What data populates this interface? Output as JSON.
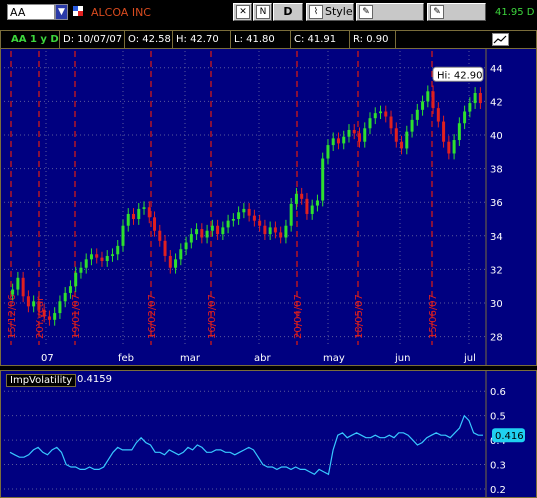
{
  "toolbar": {
    "symbol": "AA",
    "company": "ALCOA INC",
    "d_label": "D",
    "style_label": "Style",
    "drawings_label": "Drawings",
    "studies_label": "Studies",
    "last_price": "41.95 D"
  },
  "info": {
    "title": "AA 1 y D",
    "date": "D: 10/07/07",
    "open": "O: 42.58",
    "high": "H: 42.70",
    "low": "L: 41.80",
    "close": "C: 41.91",
    "range": "R: 0.90"
  },
  "chart_data": [
    {
      "type": "candlestick",
      "ylim": [
        27.5,
        45
      ],
      "y_ticks": [
        "28",
        "30",
        "32",
        "34",
        "36",
        "38",
        "40",
        "42",
        "44"
      ],
      "x_ticks": [
        "07",
        "feb",
        "mar",
        "abr",
        "may",
        "jun",
        "jul"
      ],
      "hi_label": "Hi: 42.90",
      "bubble_value": "",
      "colors": {
        "up": "#2ee02e",
        "down": "#e02020",
        "background": "#000080",
        "grid": "#5a5a9a"
      },
      "event_labels": [
        "15/12/06",
        "20Y.year",
        "19/01/07",
        "16/02/07",
        "16/03/07",
        "20/04/07",
        "18/05/07",
        "15/06/07"
      ],
      "closes": [
        30.8,
        31.5,
        30.4,
        29.8,
        30.1,
        29.6,
        29.2,
        29.0,
        29.4,
        30.1,
        30.6,
        31.0,
        31.8,
        32.1,
        32.6,
        32.9,
        32.7,
        32.5,
        32.8,
        32.9,
        33.4,
        34.6,
        35.3,
        35.0,
        35.6,
        35.7,
        35.1,
        34.3,
        33.7,
        32.8,
        32.1,
        32.6,
        33.2,
        33.6,
        34.1,
        34.4,
        33.9,
        34.3,
        34.6,
        34.1,
        34.5,
        34.9,
        35.0,
        35.4,
        35.6,
        35.2,
        34.9,
        34.6,
        34.1,
        34.5,
        34.2,
        33.9,
        34.6,
        35.9,
        36.5,
        36.2,
        35.3,
        35.8,
        36.1,
        38.6,
        39.4,
        39.8,
        39.5,
        39.9,
        40.3,
        40.1,
        39.6,
        40.4,
        41.0,
        41.3,
        41.4,
        41.1,
        40.4,
        39.6,
        39.2,
        40.2,
        40.9,
        41.5,
        42.0,
        42.6,
        41.6,
        40.8,
        39.6,
        38.9,
        39.7,
        40.7,
        41.4,
        41.9,
        42.5,
        41.9
      ],
      "title": ""
    },
    {
      "type": "line",
      "name": "ImpVolatility",
      "current_value": "0.4159",
      "bubble_value": "0.416",
      "ylim": [
        0.2,
        0.65
      ],
      "y_ticks": [
        "0.2",
        "0.3",
        "0.4",
        "0.5",
        "0.6"
      ],
      "values": [
        0.35,
        0.34,
        0.33,
        0.33,
        0.34,
        0.36,
        0.37,
        0.35,
        0.34,
        0.36,
        0.37,
        0.35,
        0.3,
        0.29,
        0.29,
        0.28,
        0.28,
        0.29,
        0.28,
        0.28,
        0.29,
        0.32,
        0.35,
        0.37,
        0.36,
        0.36,
        0.36,
        0.39,
        0.41,
        0.39,
        0.38,
        0.35,
        0.35,
        0.34,
        0.36,
        0.35,
        0.34,
        0.35,
        0.37,
        0.36,
        0.38,
        0.37,
        0.35,
        0.35,
        0.36,
        0.36,
        0.35,
        0.35,
        0.34,
        0.35,
        0.36,
        0.37,
        0.36,
        0.33,
        0.3,
        0.29,
        0.29,
        0.28,
        0.29,
        0.29,
        0.28,
        0.29,
        0.28,
        0.28,
        0.27,
        0.26,
        0.28,
        0.27,
        0.26,
        0.36,
        0.42,
        0.43,
        0.41,
        0.42,
        0.43,
        0.42,
        0.41,
        0.41,
        0.42,
        0.41,
        0.41,
        0.42,
        0.41,
        0.43,
        0.43,
        0.42,
        0.4,
        0.38,
        0.39,
        0.41,
        0.42,
        0.43,
        0.42,
        0.42,
        0.41,
        0.43,
        0.45,
        0.5,
        0.48,
        0.43,
        0.42,
        0.42
      ]
    }
  ]
}
